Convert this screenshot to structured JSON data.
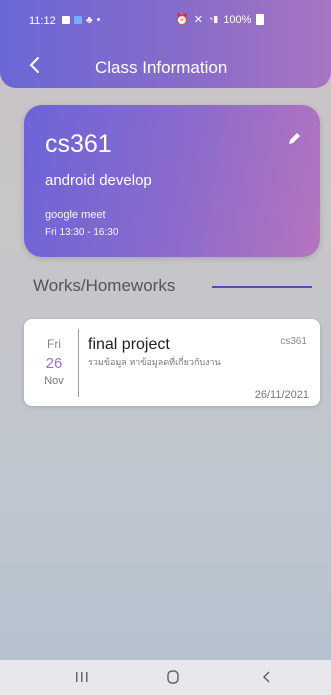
{
  "status_bar": {
    "time": "11:12",
    "dot": "•",
    "battery": "100%"
  },
  "app_bar": {
    "title": "Class Information",
    "back_icon": "chevron-left-icon"
  },
  "class": {
    "code": "cs361",
    "name": "android develop",
    "place": "google meet",
    "schedule": "Fri 13:30 - 16:30",
    "edit_icon": "pencil-icon"
  },
  "section": {
    "title": "Works/Homeworks"
  },
  "works": [
    {
      "day": "Fri",
      "date": "26",
      "month": "Nov",
      "title": "final project",
      "description": "รวมข้อมูล หาข้อมูลดที่เกี่ยวกับงาน",
      "class_code": "cs361",
      "due": "26/11/2021"
    }
  ],
  "nav": {
    "recent_icon": "recents-icon",
    "home_icon": "home-icon",
    "back_icon": "back-icon"
  },
  "colors": {
    "accent_start": "#6a67d6",
    "accent_end": "#b574be",
    "date_highlight": "#9b6fcf",
    "section_line": "#5b4aa0"
  }
}
